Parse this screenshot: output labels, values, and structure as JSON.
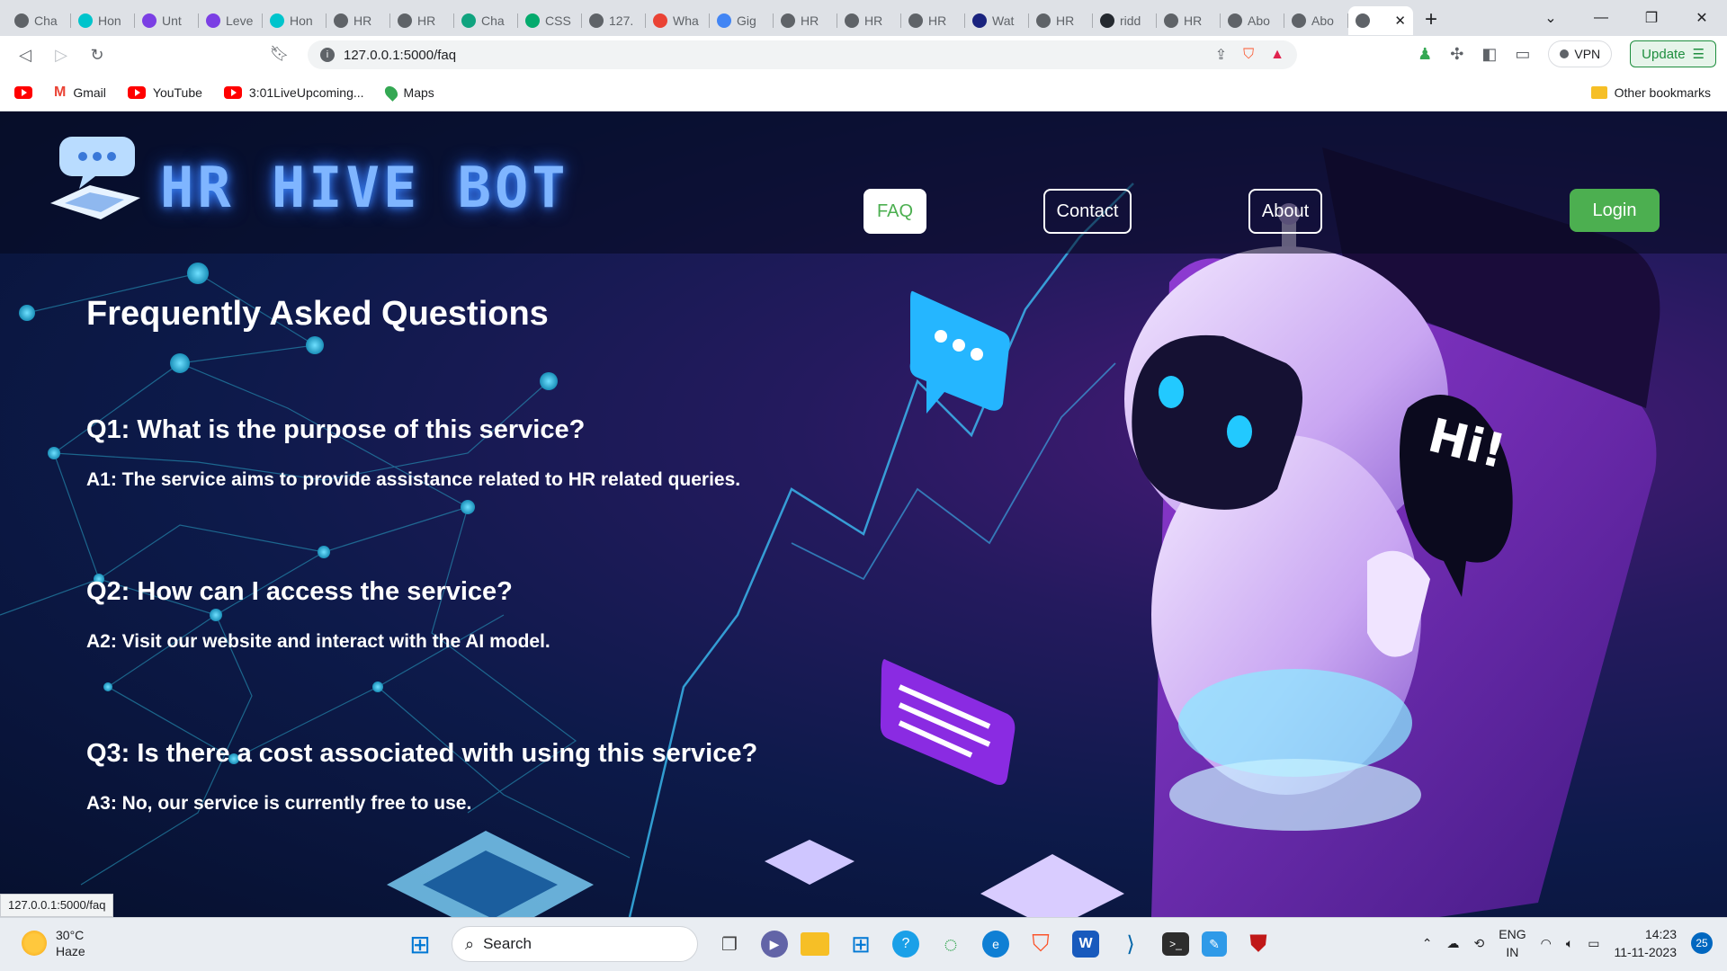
{
  "browser": {
    "tabs": [
      {
        "label": "Cha",
        "icon": "chatgpt-icon",
        "color": "#5f6368"
      },
      {
        "label": "Hon",
        "icon": "canva-icon",
        "color": "#00c4cc"
      },
      {
        "label": "Unt",
        "icon": "calendar-icon",
        "color": "#7b3fe4"
      },
      {
        "label": "Leve",
        "icon": "calendar-icon",
        "color": "#7b3fe4"
      },
      {
        "label": "Hon",
        "icon": "canva-icon",
        "color": "#00c4cc"
      },
      {
        "label": "HR",
        "icon": "globe-icon",
        "color": "#5f6368"
      },
      {
        "label": "HR",
        "icon": "globe-icon",
        "color": "#5f6368"
      },
      {
        "label": "Cha",
        "icon": "chatgpt-icon",
        "color": "#10a37f"
      },
      {
        "label": "CSS",
        "icon": "w3schools-icon",
        "color": "#04aa6d"
      },
      {
        "label": "127.",
        "icon": "globe-icon",
        "color": "#5f6368"
      },
      {
        "label": "Wha",
        "icon": "alert-icon",
        "color": "#ea4335"
      },
      {
        "label": "Gig",
        "icon": "google-icon",
        "color": "#4285f4"
      },
      {
        "label": "HR",
        "icon": "globe-icon",
        "color": "#5f6368"
      },
      {
        "label": "HR",
        "icon": "globe-icon",
        "color": "#5f6368"
      },
      {
        "label": "HR",
        "icon": "globe-icon",
        "color": "#5f6368"
      },
      {
        "label": "Wat",
        "icon": "sh-icon",
        "color": "#1a237e"
      },
      {
        "label": "HR",
        "icon": "globe-icon",
        "color": "#5f6368"
      },
      {
        "label": "ridd",
        "icon": "github-icon",
        "color": "#24292f"
      },
      {
        "label": "HR",
        "icon": "globe-icon",
        "color": "#5f6368"
      },
      {
        "label": "Abo",
        "icon": "globe-icon",
        "color": "#5f6368"
      },
      {
        "label": "Abo",
        "icon": "globe-icon",
        "color": "#5f6368"
      },
      {
        "label": "",
        "icon": "globe-icon",
        "color": "#5f6368",
        "active": true
      }
    ],
    "url": "127.0.0.1:5000/faq",
    "vpn_label": "VPN",
    "update_label": "Update",
    "bookmarks": [
      {
        "label": "",
        "icon": "youtube-icon"
      },
      {
        "label": "Gmail",
        "icon": "gmail-icon"
      },
      {
        "label": "YouTube",
        "icon": "youtube-icon"
      },
      {
        "label": "3:01LiveUpcoming...",
        "icon": "youtube-icon"
      },
      {
        "label": "Maps",
        "icon": "maps-icon"
      }
    ],
    "other_bookmarks": "Other bookmarks",
    "status_url": "127.0.0.1:5000/faq"
  },
  "site": {
    "brand": "HR HIVE BOT",
    "nav": {
      "faq": "FAQ",
      "contact": "Contact",
      "about": "About",
      "login": "Login"
    },
    "title": "Frequently Asked Questions",
    "faqs": [
      {
        "q": "Q1: What is the purpose of this service?",
        "a": "A1: The service aims to provide assistance related to HR related queries."
      },
      {
        "q": "Q2: How can I access the service?",
        "a": "A2: Visit our website and interact with the AI model."
      },
      {
        "q": "Q3: Is there a cost associated with using this service?",
        "a": "A3: No, our service is currently free to use."
      }
    ],
    "robot_speech": "Hi!",
    "colors": {
      "accent_green": "#4caf50",
      "brand_glow": "#7fb5ff"
    }
  },
  "taskbar": {
    "weather_temp": "30°C",
    "weather_desc": "Haze",
    "search_placeholder": "Search",
    "lang_top": "ENG",
    "lang_bottom": "IN",
    "time": "14:23",
    "date": "11-11-2023",
    "notification_count": "25"
  }
}
